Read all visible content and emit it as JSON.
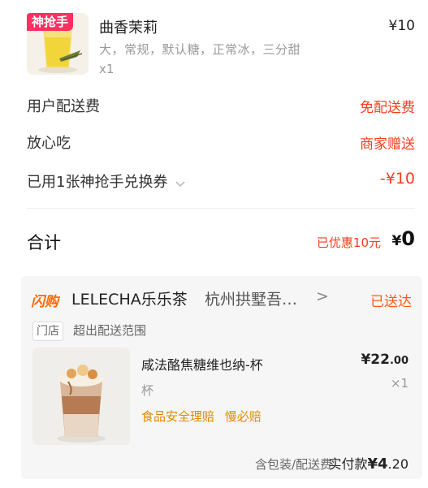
{
  "order_item": {
    "badge": "神抢手",
    "name": "曲香茉莉",
    "spec": "大，常规，默认糖，正常冰，三分甜",
    "qty": "x1",
    "price": "¥10"
  },
  "fees": [
    {
      "label": "用户配送费",
      "value": "免配送费"
    },
    {
      "label": "放心吃",
      "value": "商家赠送"
    },
    {
      "label": "已用1张神抢手兑换券",
      "value": "-¥10"
    }
  ],
  "total": {
    "label": "合计",
    "saved": "已优惠10元",
    "currency": "¥",
    "amount": "0"
  },
  "store": {
    "logo_text": "闪购",
    "name": "LELECHA乐乐茶",
    "branch": "杭州拱墅吾…",
    "arrow": ">",
    "status": "已送达",
    "tag": "门店",
    "range_note": "超出配送范围",
    "product": {
      "name": "咸法酪焦糖维也纳-杯",
      "unit": "杯",
      "price_main": "¥22",
      "price_decimal": ".00",
      "qty": "×1",
      "guarantees": [
        "食品安全理赔",
        "慢必赔"
      ]
    },
    "footer": {
      "note": "含包装/配送费",
      "paid_label": "实付款",
      "paid_currency": "¥",
      "paid_main": "4",
      "paid_decimal": ".20"
    }
  },
  "colors": {
    "accent_red": "#ff3b1f",
    "badge_pink": "#ff2e63",
    "status_orange": "#ff5a1f",
    "guarantee_orange": "#e08a00"
  }
}
